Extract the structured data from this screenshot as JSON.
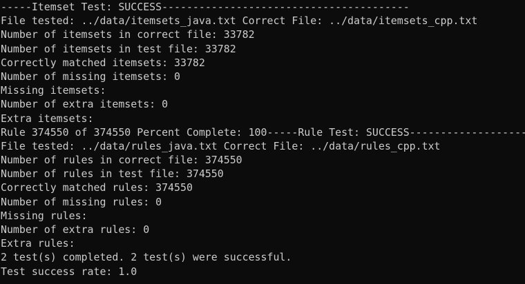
{
  "terminal": {
    "background_color": "#0c0c0c",
    "text_color": "#cccccc",
    "lines": [
      "-----Itemset Test: SUCCESS----------------------------------------",
      "File tested: ../data/itemsets_java.txt Correct File: ../data/itemsets_cpp.txt",
      "Number of itemsets in correct file: 33782",
      "Number of itemsets in test file: 33782",
      "Correctly matched itemsets: 33782",
      "Number of missing itemsets: 0",
      "Missing itemsets:",
      "Number of extra itemsets: 0",
      "Extra itemsets:",
      "Rule 374550 of 374550 Percent Complete: 100-----Rule Test: SUCCESS--------------------",
      "File tested: ../data/rules_java.txt Correct File: ../data/rules_cpp.txt",
      "Number of rules in correct file: 374550",
      "Number of rules in test file: 374550",
      "Correctly matched rules: 374550",
      "Number of missing rules: 0",
      "Missing rules:",
      "Number of extra rules: 0",
      "Extra rules:",
      "2 test(s) completed. 2 test(s) were successful.",
      "Test success rate: 1.0"
    ]
  }
}
